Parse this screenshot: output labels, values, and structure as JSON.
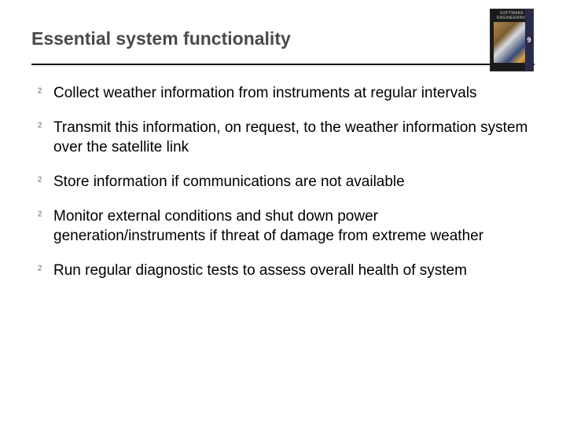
{
  "title": "Essential system functionality",
  "thumbnail": {
    "top_label": "SOFTWARE ENGINEERING",
    "spine_number": "9",
    "alt": "book-cover-thumbnail"
  },
  "bullets": [
    "Collect weather information from instruments at regular intervals",
    "Transmit this information, on request, to the weather information system over the satellite link",
    "Store information if communications are not available",
    "Monitor external conditions and shut down power generation/instruments if threat of damage from extreme weather",
    "Run regular diagnostic tests to assess overall health of system"
  ],
  "bullet_glyph": "²"
}
